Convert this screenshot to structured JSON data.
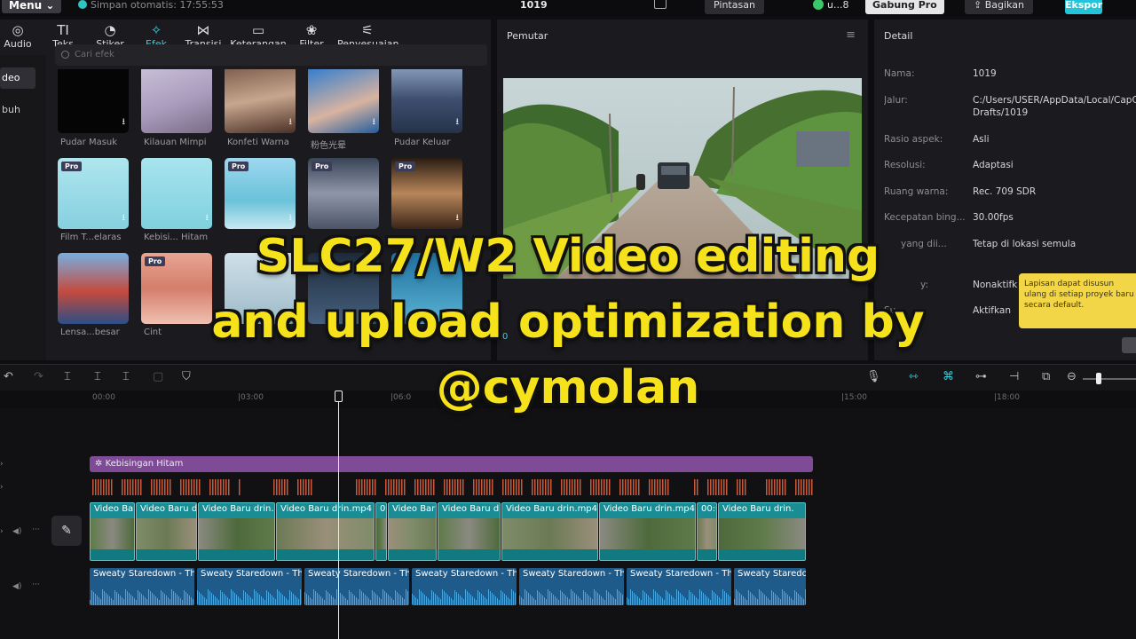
{
  "app": {
    "menu_label": "Menu",
    "autosave": "Simpan otomatis: 17:55:53",
    "project_name": "1019",
    "shortcut_label": "Pintasan",
    "user_label": "u...8",
    "join_pro": "Gabung Pro",
    "share_label": "Bagikan",
    "export_label": "Ekspor"
  },
  "tabs": [
    {
      "label": "Audio",
      "icon": "audio-icon"
    },
    {
      "label": "Teks",
      "icon": "text-icon"
    },
    {
      "label": "Stiker",
      "icon": "sticker-icon"
    },
    {
      "label": "Efek",
      "icon": "effects-icon",
      "active": true
    },
    {
      "label": "Transisi",
      "icon": "transition-icon"
    },
    {
      "label": "Keterangan",
      "icon": "caption-icon"
    },
    {
      "label": "Filter",
      "icon": "filter-icon"
    },
    {
      "label": "Penyesuaian",
      "icon": "adjust-icon"
    }
  ],
  "left_nav": [
    "deo",
    "buh"
  ],
  "search_placeholder": "Cari efek",
  "effects": {
    "row1": [
      "Pudar Masuk",
      "Kilauan Mimpi",
      "Konfeti Warna",
      "粉色光晕",
      "Pudar Keluar"
    ],
    "row2": [
      "Film T...elaras",
      "Kebisi... Hitam"
    ],
    "row3": [
      "Lensa...besar",
      "Cint"
    ],
    "pro_badge": "Pro"
  },
  "player": {
    "title": "Pemutar",
    "timecode": "0"
  },
  "detail": {
    "title": "Detail",
    "rows": [
      {
        "label": "Nama:",
        "value": "1019"
      },
      {
        "label": "Jalur:",
        "value": "C:/Users/USER/AppData/Local/CapCut",
        "value2": "Drafts/1019"
      },
      {
        "label": "Rasio aspek:",
        "value": "Asli"
      },
      {
        "label": "Resolusi:",
        "value": "Adaptasi"
      },
      {
        "label": "Ruang warna:",
        "value": "Rec. 709 SDR"
      },
      {
        "label": "Kecepatan bing...",
        "value": "30.00fps"
      },
      {
        "label": "yang dii...",
        "value": "Tetap di lokasi semula"
      },
      {
        "label": "y:",
        "value": "Nonaktifk"
      },
      {
        "label": "Su",
        "value": "Aktifkan"
      }
    ],
    "tooltip": "Lapisan dapat disusun ulang di setiap proyek baru secara default."
  },
  "timeline": {
    "ruler": [
      "00:00",
      "|03:00",
      "|06:0",
      "|15:00",
      "|18:00"
    ],
    "effect_clip": "Kebisingan Hitam",
    "video_clips": [
      "Video Bar",
      "Video Baru dr",
      "Video Baru drin.n",
      "Video Baru drin.mp4",
      "00",
      "Video Bar",
      "Video Baru dri",
      "Video Baru drin.mp4",
      "Video Baru drin.mp4",
      "00:0",
      "Video Baru drin."
    ],
    "audio_clips": [
      "Sweaty Staredown - The",
      "Sweaty Staredown - The",
      "Sweaty Staredown - The",
      "Sweaty Staredown - The",
      "Sweaty Staredown - The",
      "Sweaty Staredown - The",
      "Sweaty Staredown"
    ]
  },
  "overlay_title": {
    "line1": "SLC27/W2 Video editing",
    "line2": "and upload optimization by",
    "line3": "@cymolan"
  }
}
